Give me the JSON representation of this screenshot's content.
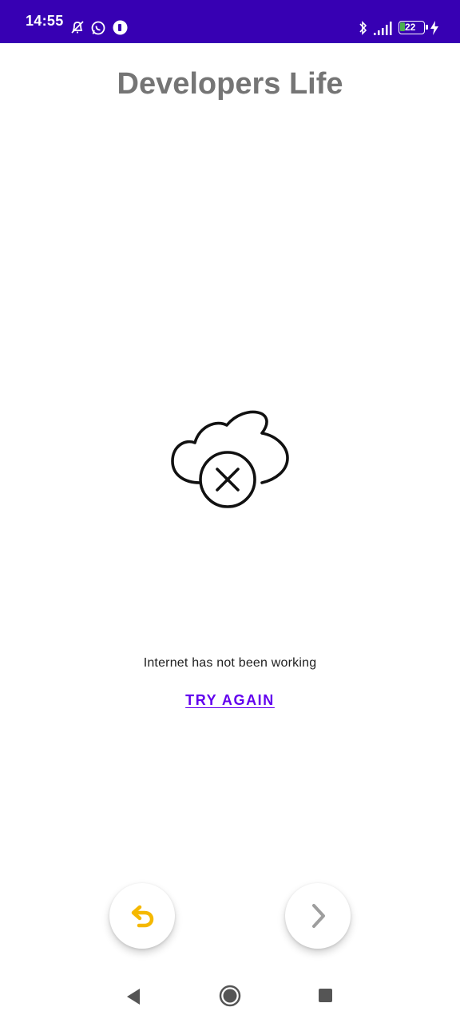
{
  "status_bar": {
    "time": "14:55",
    "battery_level": "22",
    "background_color": "#3700b3",
    "left_icons": [
      "alarm-off-icon",
      "whatsapp-icon",
      "circle-app-icon"
    ],
    "right_icons": [
      "bluetooth-icon",
      "signal-icon",
      "battery-icon",
      "charging-icon"
    ]
  },
  "app": {
    "title": "Developers Life"
  },
  "error": {
    "icon": "cloud-error-icon",
    "message": "Internet has not been working",
    "retry_label": "TRY AGAIN",
    "retry_color": "#6200ee"
  },
  "fabs": {
    "back_icon": "undo-icon",
    "back_color": "#f5b800",
    "next_icon": "chevron-right-icon",
    "next_color": "#9e9e9e"
  },
  "nav_bar": {
    "buttons": [
      "back-triangle-icon",
      "home-circle-icon",
      "recents-square-icon"
    ]
  }
}
